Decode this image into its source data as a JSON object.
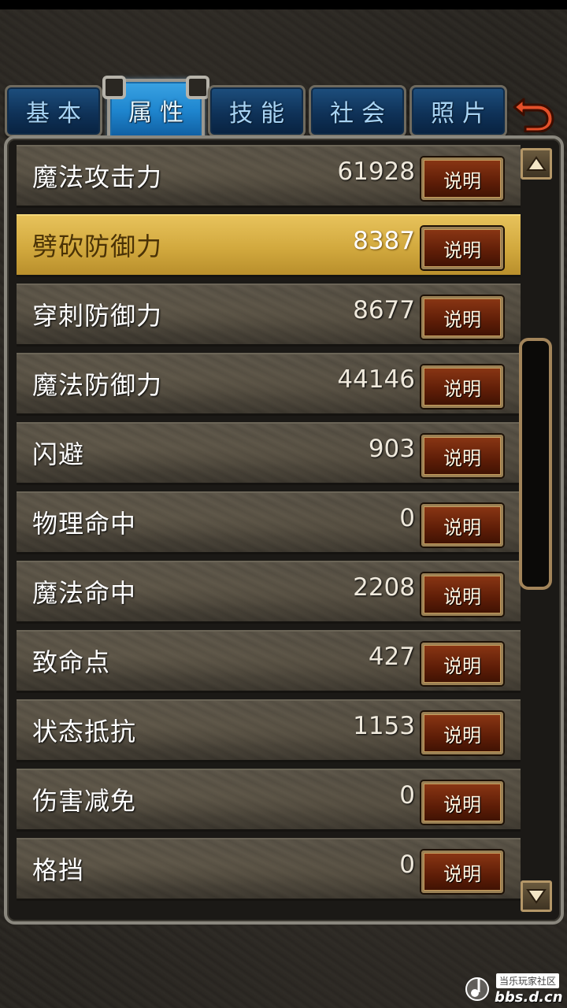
{
  "tabs": [
    {
      "label": "基本",
      "active": false
    },
    {
      "label": "属性",
      "active": true
    },
    {
      "label": "技能",
      "active": false
    },
    {
      "label": "社会",
      "active": false
    },
    {
      "label": "照片",
      "active": false
    }
  ],
  "attributes": [
    {
      "name": "魔法攻击力",
      "value": "61928",
      "button": "说明"
    },
    {
      "name": "劈砍防御力",
      "value": "8387",
      "button": "说明"
    },
    {
      "name": "穿刺防御力",
      "value": "8677",
      "button": "说明"
    },
    {
      "name": "魔法防御力",
      "value": "44146",
      "button": "说明"
    },
    {
      "name": "闪避",
      "value": "903",
      "button": "说明"
    },
    {
      "name": "物理命中",
      "value": "0",
      "button": "说明"
    },
    {
      "name": "魔法命中",
      "value": "2208",
      "button": "说明"
    },
    {
      "name": "致命点",
      "value": "427",
      "button": "说明"
    },
    {
      "name": "状态抵抗",
      "value": "1153",
      "button": "说明"
    },
    {
      "name": "伤害减免",
      "value": "0",
      "button": "说明"
    },
    {
      "name": "格挡",
      "value": "0",
      "button": "说明"
    }
  ],
  "watermark": {
    "top": "当乐玩家社区",
    "bottom": "bbs.d.cn"
  },
  "icons": {
    "back": "back-arrow-icon",
    "scroll_up": "arrow-up-icon",
    "scroll_down": "arrow-down-icon"
  },
  "colors": {
    "tab_blue": "#0f3258",
    "tab_active": "#1f86cf",
    "highlight_gold": "#d2a93e",
    "button_brown": "#5e1d07",
    "back_arrow": "#e2502a"
  }
}
